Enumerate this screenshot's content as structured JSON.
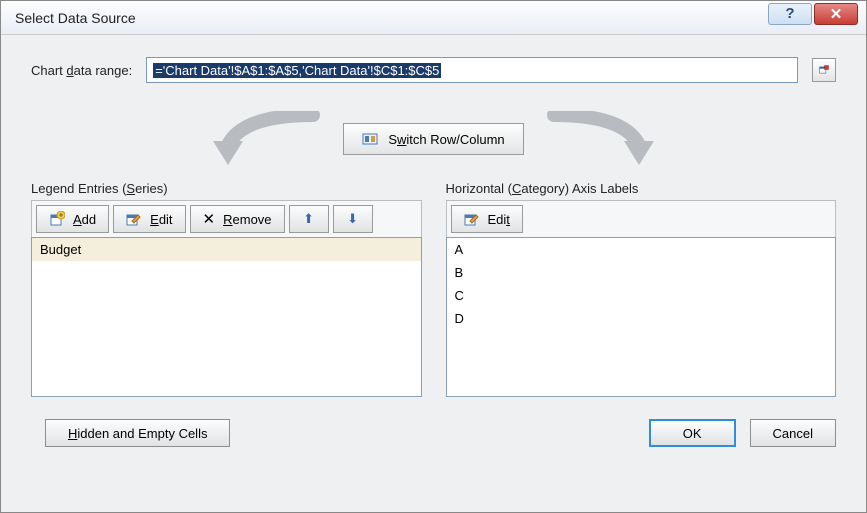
{
  "title": "Select Data Source",
  "range": {
    "label": "Chart data range:",
    "value": "='Chart Data'!$A$1:$A$5,'Chart Data'!$C$1:$C$5"
  },
  "switch_button": "Switch Row/Column",
  "legend": {
    "label": "Legend Entries (Series)",
    "add": "Add",
    "edit": "Edit",
    "remove": "Remove",
    "items": [
      "Budget"
    ]
  },
  "axis": {
    "label": "Horizontal (Category) Axis Labels",
    "edit": "Edit",
    "items": [
      "A",
      "B",
      "C",
      "D"
    ]
  },
  "footer": {
    "hidden": "Hidden and Empty Cells",
    "ok": "OK",
    "cancel": "Cancel"
  }
}
